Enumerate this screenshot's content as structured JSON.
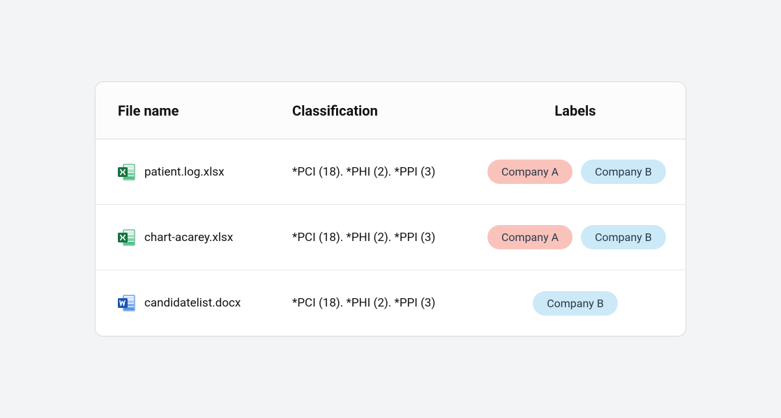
{
  "headers": {
    "file": "File name",
    "classification": "Classification",
    "labels": "Labels"
  },
  "rows": [
    {
      "icon": "excel",
      "filename": "patient.log.xlsx",
      "classification": "*PCI (18). *PHI (2). *PPI (3)",
      "labels": [
        {
          "text": "Company A",
          "variant": "a"
        },
        {
          "text": "Company B",
          "variant": "b"
        }
      ]
    },
    {
      "icon": "excel",
      "filename": "chart-acarey.xlsx",
      "classification": "*PCI (18). *PHI (2). *PPI (3)",
      "labels": [
        {
          "text": "Company A",
          "variant": "a"
        },
        {
          "text": "Company B",
          "variant": "b"
        }
      ]
    },
    {
      "icon": "word",
      "filename": "candidatelist.docx",
      "classification": "*PCI (18). *PHI (2). *PPI (3)",
      "labels": [
        {
          "text": "Company B",
          "variant": "b"
        }
      ]
    }
  ]
}
